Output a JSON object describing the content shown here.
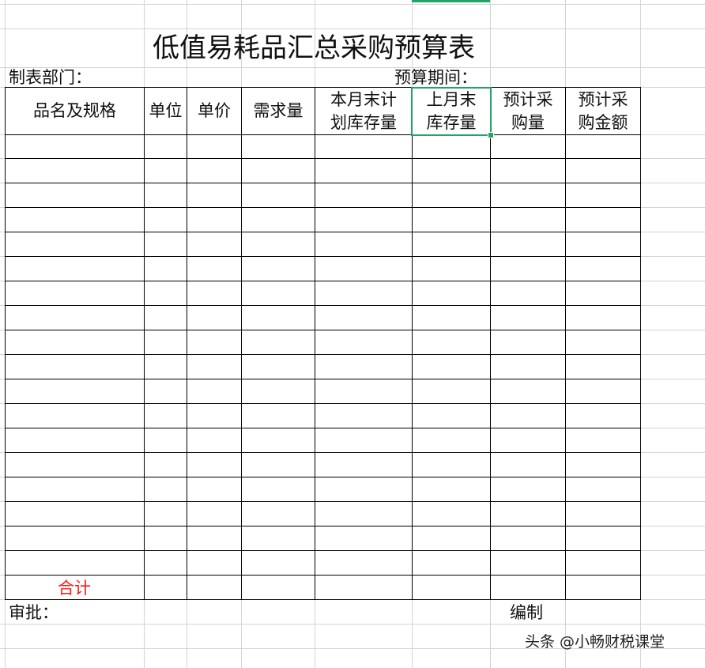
{
  "sheet": {
    "title": "低值易耗品汇总采购预算表",
    "dept_label": "制表部门：",
    "period_label": "预算期间：",
    "approve_label": "审批：",
    "prepared_label": "编制",
    "total_label": "合计",
    "headers": [
      [
        "品名及规格"
      ],
      [
        "单位"
      ],
      [
        "单价"
      ],
      [
        "需求量"
      ],
      [
        "本月末计",
        "划库存量"
      ],
      [
        "上月末",
        "库存量"
      ],
      [
        "预计采",
        "购量"
      ],
      [
        "预计采",
        "购金额"
      ]
    ],
    "selected_header_index": 5
  },
  "watermark": "头条 @小畅财税课堂",
  "colors": {
    "gridline": "#d4d4d4",
    "border": "#000000",
    "selection": "#21a366",
    "total_text": "#ff1a1a"
  }
}
